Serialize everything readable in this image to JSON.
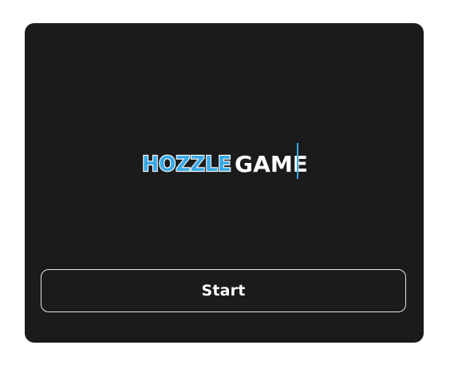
{
  "logo": {
    "word_one": "HOZZLE",
    "word_two": "GAME",
    "word_one_color": "#3aa9e6",
    "word_one_stroke": "#ffffff",
    "word_two_color": "#ffffff",
    "cursor_color": "#3aa9e6"
  },
  "start_button": {
    "label": "Start"
  },
  "colors": {
    "page_background": "#ffffff",
    "card_background": "#1b1b1b",
    "button_border": "#e6e6e6",
    "button_text": "#ffffff"
  }
}
